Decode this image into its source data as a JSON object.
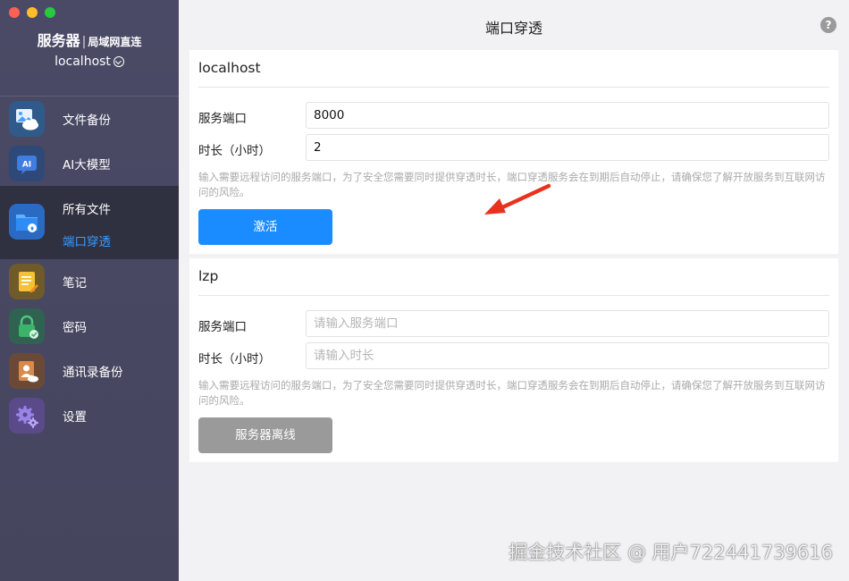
{
  "sidebar": {
    "brand_main": "服务器",
    "brand_sep": "|",
    "brand_sub": "局域网直连",
    "host": "localhost",
    "items": [
      {
        "label": "文件备份",
        "icon": "cloud-photo-icon"
      },
      {
        "label": "AI大模型",
        "icon": "ai-icon"
      },
      {
        "label": "所有文件",
        "sublabel": "端口穿透",
        "icon": "folder-icon",
        "active": true
      },
      {
        "label": "笔记",
        "icon": "notes-icon"
      },
      {
        "label": "密码",
        "icon": "lock-icon"
      },
      {
        "label": "通讯录备份",
        "icon": "contacts-icon"
      },
      {
        "label": "设置",
        "icon": "gear-icon"
      }
    ]
  },
  "header": {
    "title": "端口穿透",
    "help": "?"
  },
  "cards": [
    {
      "name": "localhost",
      "port_label": "服务端口",
      "port_value": "8000",
      "port_placeholder": "",
      "duration_label": "时长（小时）",
      "duration_value": "2",
      "duration_placeholder": "",
      "hint": "输入需要远程访问的服务端口，为了安全您需要同时提供穿透时长，端口穿透服务会在到期后自动停止，请确保您了解开放服务到互联网访问的风险。",
      "button": "激活",
      "button_state": "active"
    },
    {
      "name": "lzp",
      "port_label": "服务端口",
      "port_value": "",
      "port_placeholder": "请输入服务端口",
      "duration_label": "时长（小时）",
      "duration_value": "",
      "duration_placeholder": "请输入时长",
      "hint": "输入需要远程访问的服务端口，为了安全您需要同时提供穿透时长，端口穿透服务会在到期后自动停止，请确保您了解开放服务到互联网访问的风险。",
      "button": "服务器离线",
      "button_state": "disabled"
    }
  ],
  "watermark": "掘金技术社区 @ 用户722441739616",
  "colors": {
    "accent": "#1a8cff",
    "active_nav_text": "#3a9dff",
    "arrow": "#e8321e",
    "disabled_button": "#9a9a9a"
  }
}
